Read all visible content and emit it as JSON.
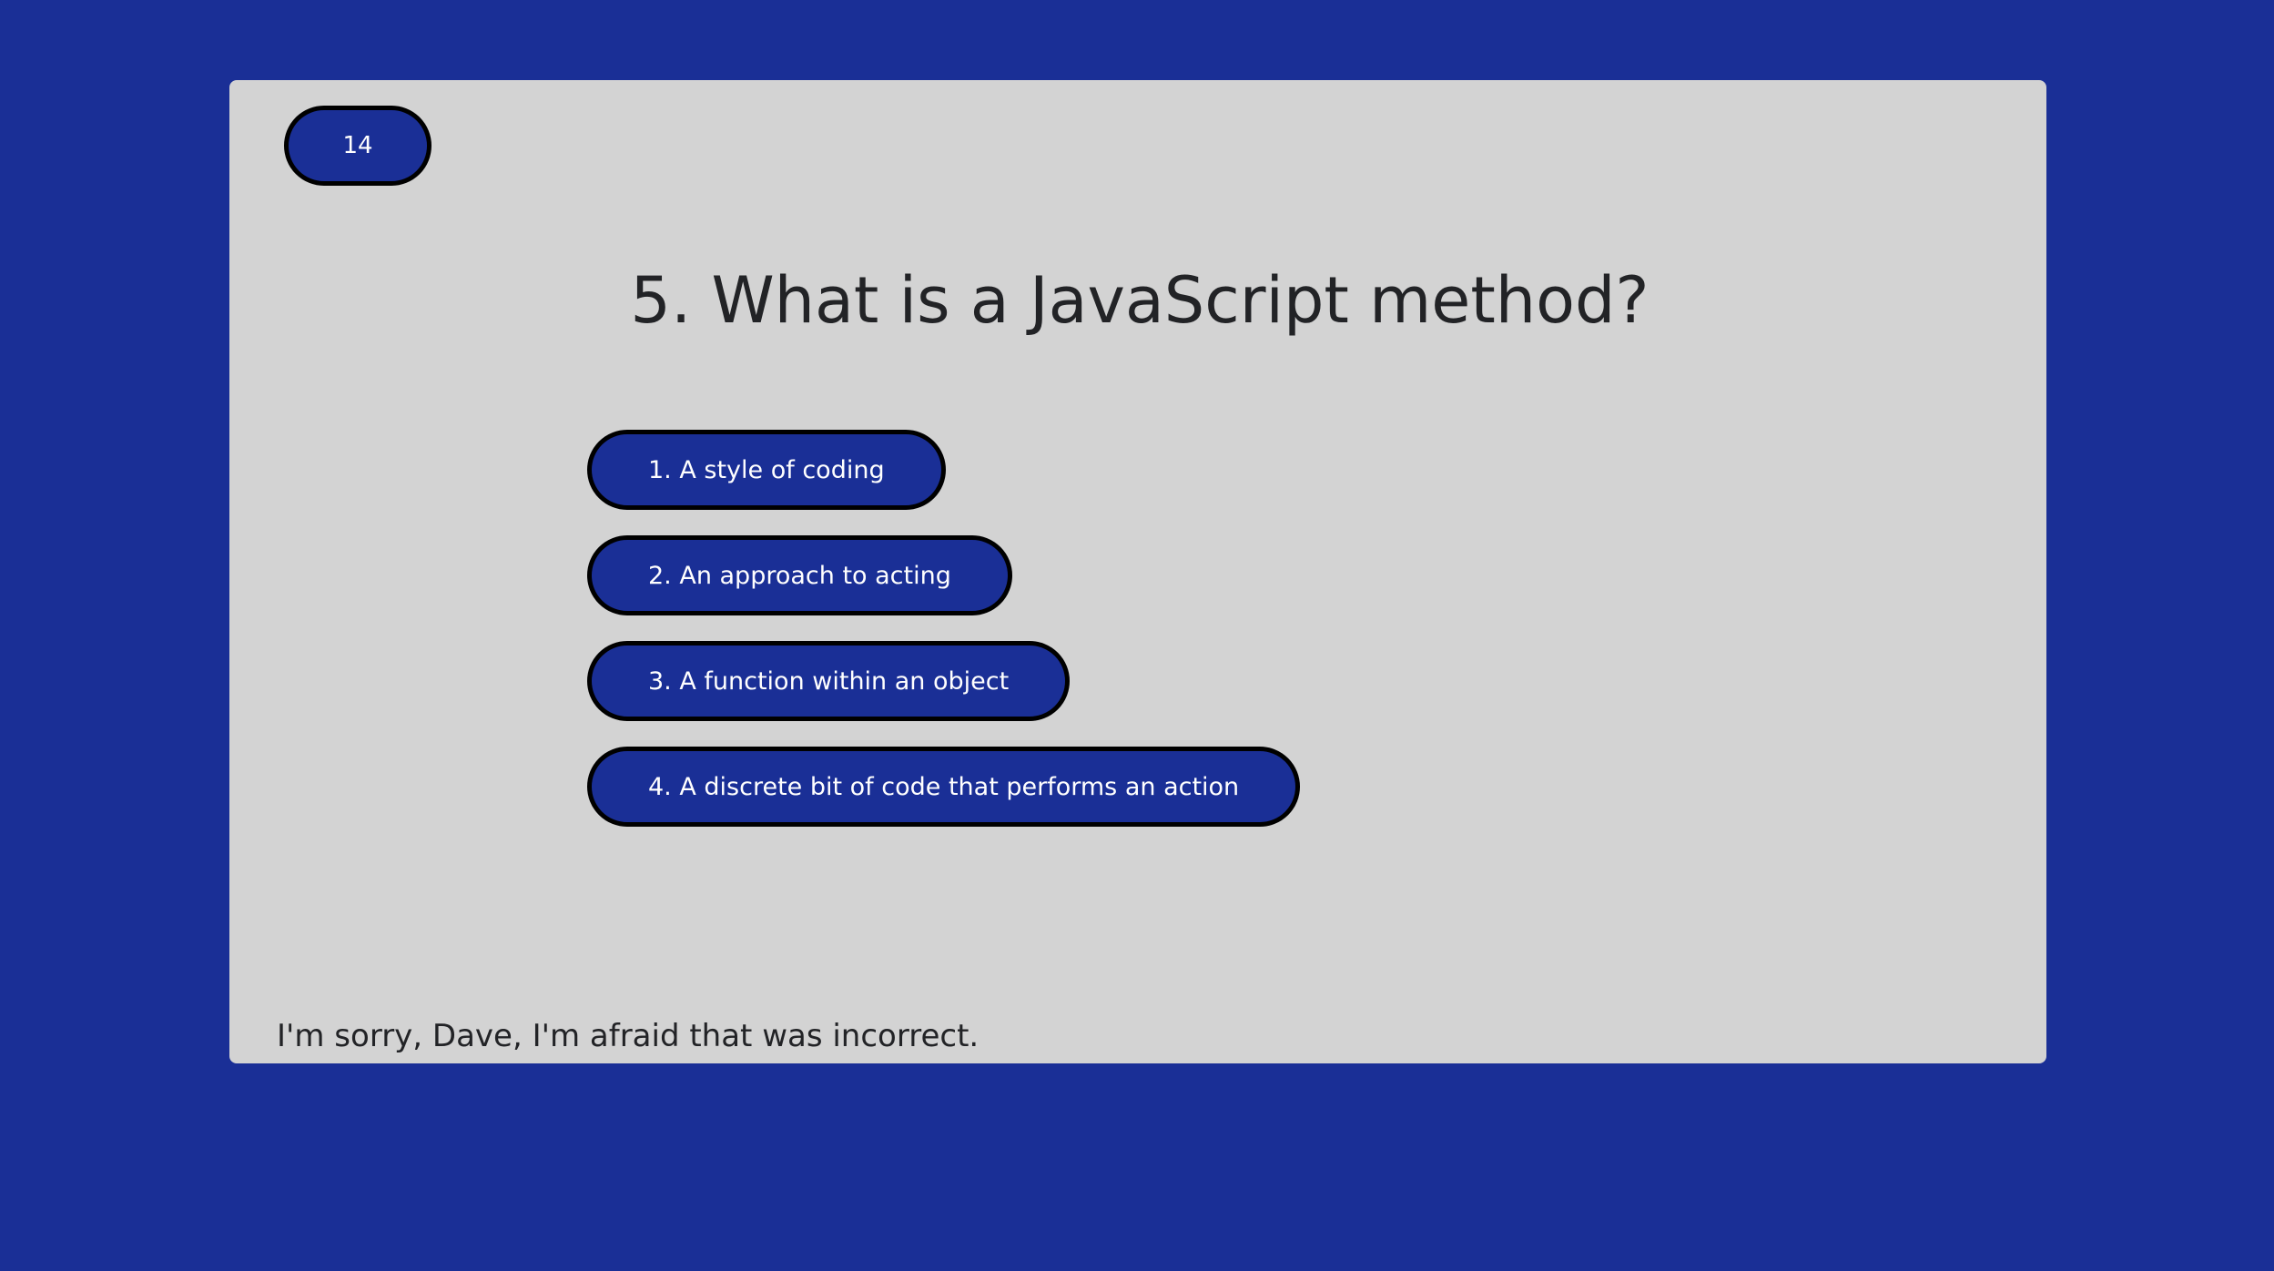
{
  "timer": {
    "value": "14"
  },
  "question": {
    "text": "5. What is a JavaScript method?"
  },
  "answers": [
    {
      "label": "1. A style of coding"
    },
    {
      "label": "2. An approach to acting"
    },
    {
      "label": "3. A function within an object"
    },
    {
      "label": "4. A discrete bit of code that performs an action"
    }
  ],
  "feedback": {
    "text": "I'm sorry, Dave, I'm afraid that was incorrect."
  },
  "colors": {
    "background": "#1a2f96",
    "card": "#d3d3d3",
    "button": "#1a2f96",
    "button_border": "#000000",
    "text_dark": "#222326",
    "text_light": "#ffffff"
  }
}
